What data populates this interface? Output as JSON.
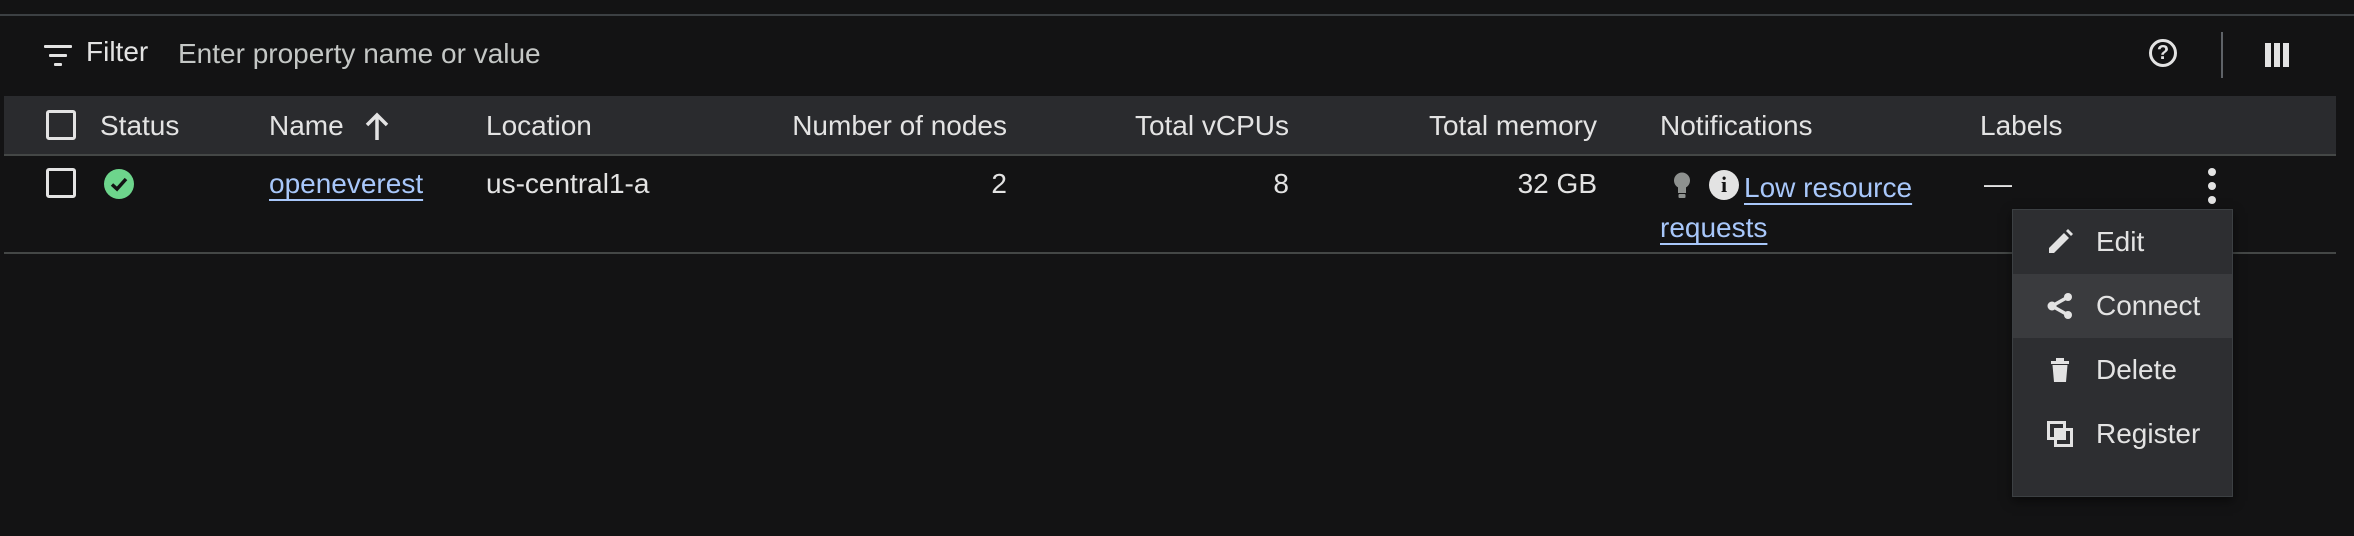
{
  "filter": {
    "label": "Filter",
    "placeholder": "Enter property name or value",
    "value": ""
  },
  "toolbar": {
    "help_icon": "help-circle-icon",
    "help_glyph": "?",
    "columns_icon": "column-display-icon"
  },
  "table": {
    "columns": {
      "status": "Status",
      "name": "Name",
      "location": "Location",
      "nodes": "Number of nodes",
      "vcpus": "Total vCPUs",
      "memory": "Total memory",
      "notifications": "Notifications",
      "labels": "Labels"
    },
    "sort": {
      "column": "Name",
      "direction": "ascending"
    },
    "rows": [
      {
        "status": "ok",
        "name": "openeverest",
        "location": "us-central1-a",
        "nodes": "2",
        "vcpus": "8",
        "memory": "32 GB",
        "notification": "Low resource requests",
        "info_glyph": "i",
        "labels": "—"
      }
    ]
  },
  "menu": {
    "items": [
      {
        "label": "Edit",
        "icon": "edit-pencil-icon"
      },
      {
        "label": "Connect",
        "icon": "share-connect-icon"
      },
      {
        "label": "Delete",
        "icon": "trash-icon"
      },
      {
        "label": "Register",
        "icon": "register-icon"
      }
    ],
    "hovered": "Connect"
  },
  "colors": {
    "background": "#131314",
    "header_bg": "#2a2b2e",
    "link": "#a8c7fa",
    "status_ok": "#6dd58c",
    "menu_bg": "#2d2e31"
  }
}
